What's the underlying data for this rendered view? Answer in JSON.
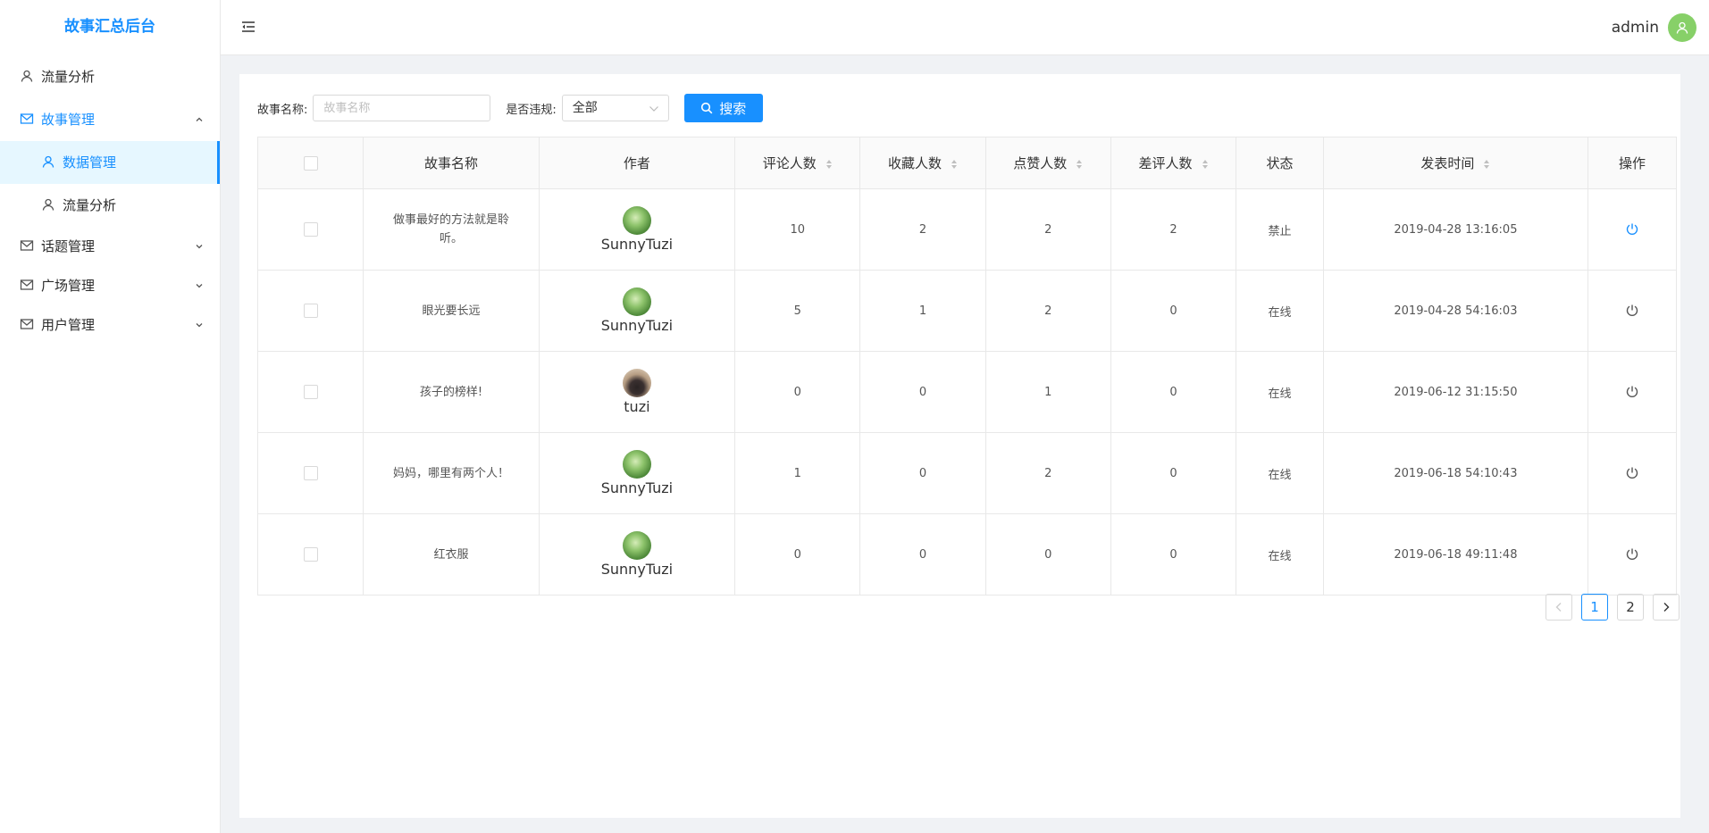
{
  "app": {
    "title": "故事汇总后台"
  },
  "sidebar": {
    "items": [
      {
        "label": "流量分析",
        "icon": "user-icon"
      },
      {
        "label": "故事管理",
        "icon": "mail-icon",
        "expanded": true
      },
      {
        "label": "数据管理",
        "icon": "user-icon",
        "active": true
      },
      {
        "label": "流量分析",
        "icon": "user-icon"
      },
      {
        "label": "话题管理",
        "icon": "mail-icon"
      },
      {
        "label": "广场管理",
        "icon": "mail-icon"
      },
      {
        "label": "用户管理",
        "icon": "mail-icon"
      }
    ]
  },
  "header": {
    "username": "admin"
  },
  "search": {
    "name_label": "故事名称:",
    "name_placeholder": "故事名称",
    "violation_label": "是否违规:",
    "violation_value": "全部",
    "button_label": "搜索"
  },
  "table": {
    "columns": [
      "故事名称",
      "作者",
      "评论人数",
      "收藏人数",
      "点赞人数",
      "差评人数",
      "状态",
      "发表时间",
      "操作"
    ],
    "rows": [
      {
        "name": "做事最好的方法就是聆听。",
        "author": "SunnyTuzi",
        "avatar": "leaf",
        "comments": "10",
        "favorites": "2",
        "likes": "2",
        "dislikes": "2",
        "status": "禁止",
        "time": "2019-04-28 13:16:05",
        "action_active": true
      },
      {
        "name": "眼光要长远",
        "author": "SunnyTuzi",
        "avatar": "leaf",
        "comments": "5",
        "favorites": "1",
        "likes": "2",
        "dislikes": "0",
        "status": "在线",
        "time": "2019-04-28 54:16:03",
        "action_active": false
      },
      {
        "name": "孩子的榜样!",
        "author": "tuzi",
        "avatar": "dog",
        "comments": "0",
        "favorites": "0",
        "likes": "1",
        "dislikes": "0",
        "status": "在线",
        "time": "2019-06-12 31:15:50",
        "action_active": false
      },
      {
        "name": "妈妈，哪里有两个人！",
        "author": "SunnyTuzi",
        "avatar": "leaf",
        "comments": "1",
        "favorites": "0",
        "likes": "2",
        "dislikes": "0",
        "status": "在线",
        "time": "2019-06-18 54:10:43",
        "action_active": false
      },
      {
        "name": "红衣服",
        "author": "SunnyTuzi",
        "avatar": "leaf",
        "comments": "0",
        "favorites": "0",
        "likes": "0",
        "dislikes": "0",
        "status": "在线",
        "time": "2019-06-18 49:11:48",
        "action_active": false
      }
    ]
  },
  "pagination": {
    "pages": [
      "1",
      "2"
    ],
    "current": "1"
  },
  "colors": {
    "primary": "#1890ff",
    "avatar_bg": "#87d068",
    "menu_active_bg": "#e6f7ff"
  }
}
